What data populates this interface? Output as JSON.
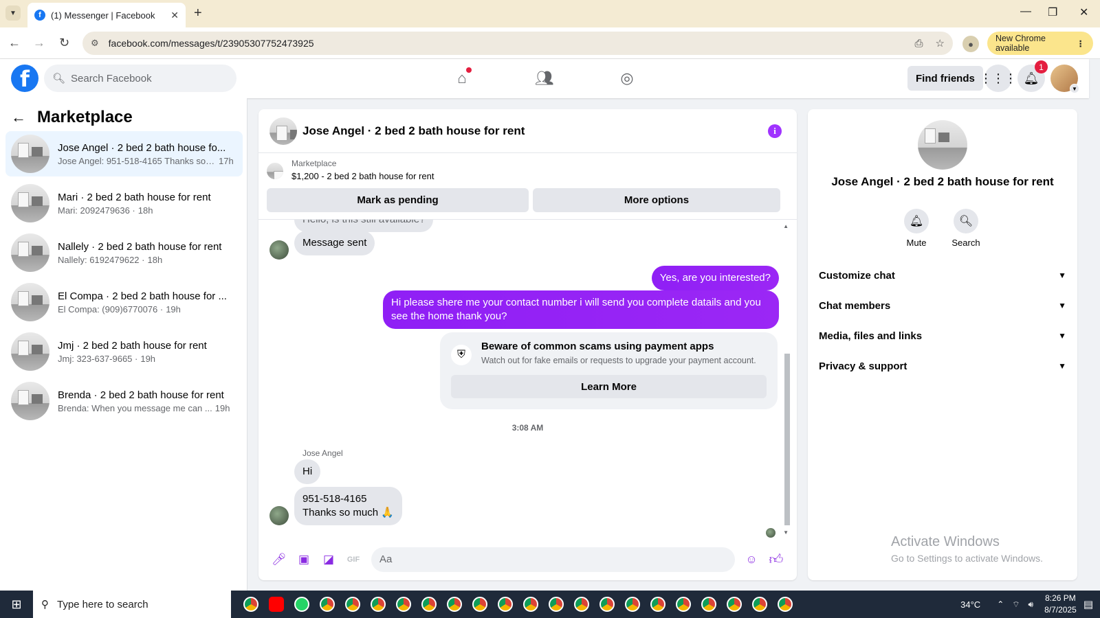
{
  "browser": {
    "tab_title": "(1) Messenger | Facebook",
    "url": "facebook.com/messages/t/23905307752473925",
    "update_label": "New Chrome available"
  },
  "header": {
    "search_placeholder": "Search Facebook",
    "find_friends": "Find friends",
    "notification_count": "1"
  },
  "sidebar": {
    "title": "Marketplace",
    "conversations": [
      {
        "name": "Jose Angel · 2 bed 2 bath house fo...",
        "preview": "Jose Angel: 951-518-4165 Thanks so... ·",
        "time": "17h",
        "active": true
      },
      {
        "name": "Mari · 2 bed 2 bath house for rent",
        "preview": "Mari: 2092479636 ·",
        "time": "18h"
      },
      {
        "name": "Nallely · 2 bed 2 bath house for rent",
        "preview": "Nallely: 6192479622 ·",
        "time": "18h"
      },
      {
        "name": "El Compa · 2 bed 2 bath house for ...",
        "preview": "El Compa: (909)6770076 ·",
        "time": "19h"
      },
      {
        "name": "Jmj · 2 bed 2 bath house for rent",
        "preview": "Jmj: 323-637-9665 ·",
        "time": "19h"
      },
      {
        "name": "Brenda · 2 bed 2 bath house for rent",
        "preview": "Brenda: When you message me can ...",
        "time": "19h"
      }
    ]
  },
  "chat": {
    "title": "Jose Angel · 2 bed 2 bath house for rent",
    "marketplace_label": "Marketplace",
    "listing": "$1,200 - 2 bed 2 bath house for rent",
    "mark_pending": "Mark as pending",
    "more_options": "More options",
    "partial_msg": "Hello, is this still available?",
    "msg_sent": "Message sent",
    "out_1": "Yes, are you interested?",
    "out_2": "Hi please shere me your contact number i will send you complete datails and you see the home thank you?",
    "warn_title": "Beware of common scams using payment apps",
    "warn_sub": "Watch out for fake emails or requests to upgrade your payment account.",
    "learn_more": "Learn More",
    "timestamp": "3:08 AM",
    "sender_name": "Jose Angel",
    "in_hi": "Hi",
    "in_phone": "951-518-4165",
    "in_thanks": "Thanks so much 🙏",
    "composer_placeholder": "Aa"
  },
  "info_panel": {
    "title": "Jose Angel · 2 bed 2 bath house for rent",
    "mute": "Mute",
    "search": "Search",
    "sections": [
      "Customize chat",
      "Chat members",
      "Media, files and links",
      "Privacy & support"
    ]
  },
  "watermark": {
    "line1": "Activate Windows",
    "line2": "Go to Settings to activate Windows."
  },
  "taskbar": {
    "search_placeholder": "Type here to search",
    "temperature": "34°C",
    "time": "8:26 PM",
    "date": "8/7/2025"
  }
}
